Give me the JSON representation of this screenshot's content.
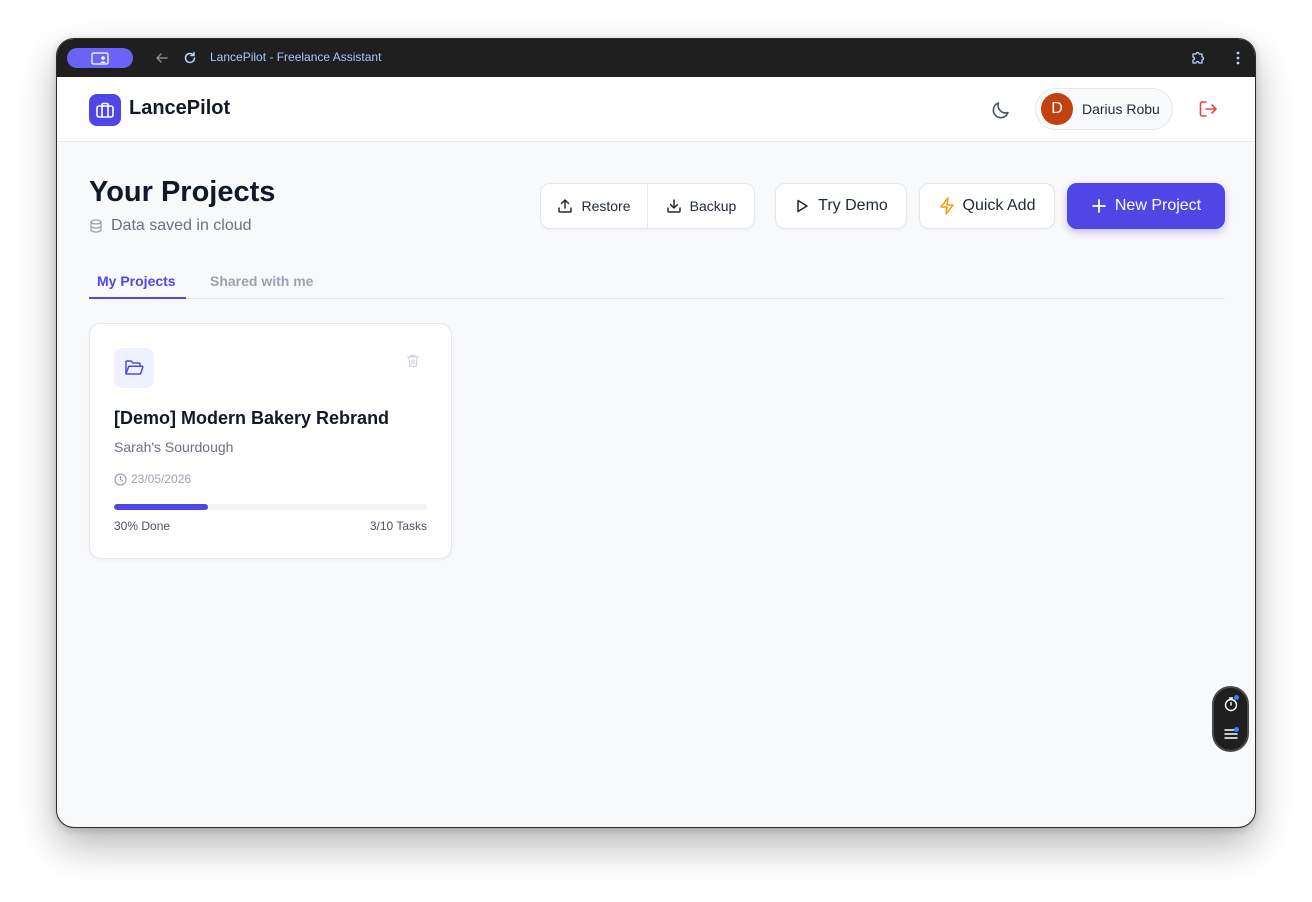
{
  "browser": {
    "title": "LancePilot - Freelance Assistant"
  },
  "app": {
    "name": "LancePilot",
    "user": {
      "initial": "D",
      "name": "Darius Robu"
    }
  },
  "page": {
    "title": "Your Projects",
    "storage_status": "Data saved in cloud"
  },
  "toolbar": {
    "restore_label": "Restore",
    "backup_label": "Backup",
    "try_demo_label": "Try Demo",
    "quick_add_label": "Quick Add",
    "new_project_label": "New Project"
  },
  "tabs": [
    {
      "label": "My Projects",
      "active": true
    },
    {
      "label": "Shared with me",
      "active": false
    }
  ],
  "projects": [
    {
      "title": "[Demo] Modern Bakery Rebrand",
      "client": "Sarah's Sourdough",
      "date": "23/05/2026",
      "progress_percent": 30,
      "progress_label": "30% Done",
      "tasks_label": "3/10 Tasks"
    }
  ],
  "colors": {
    "accent": "#4f46e5",
    "avatar": "#c2410c",
    "logout": "#ef4444",
    "quick_add_icon": "#f59e0b"
  },
  "icons": {
    "logo": "briefcase-icon",
    "theme": "moon-icon",
    "logout": "logout-icon",
    "restore": "upload-icon",
    "backup": "download-icon",
    "try_demo": "play-icon",
    "quick_add": "lightning-icon",
    "new_project": "plus-icon",
    "project": "folder-open-icon",
    "delete": "trash-icon",
    "date": "clock-icon",
    "storage": "database-icon"
  }
}
